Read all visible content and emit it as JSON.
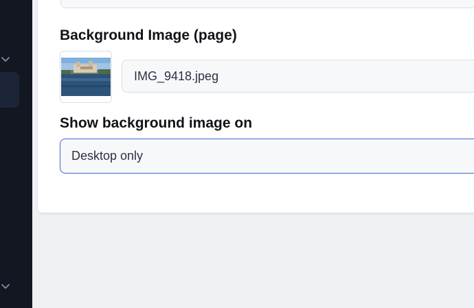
{
  "sidebar": {
    "collapse_icon": "chevron-down-icon",
    "background_color": "#121722"
  },
  "background_image": {
    "label": "Background Image (page)",
    "file_name": "IMG_9418.jpeg",
    "thumbnail_icon": "image-thumbnail"
  },
  "show_background": {
    "label": "Show background image on",
    "selected": "Desktop only"
  },
  "colors": {
    "accent": "#3b63d1",
    "text": "#111318",
    "field_bg": "#f7f8fa"
  }
}
